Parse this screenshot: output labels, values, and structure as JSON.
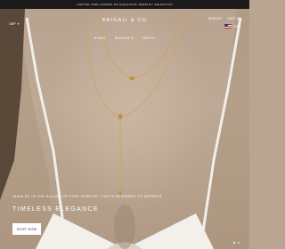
{
  "announcement": "LIMITED-TIME OFFERS ON EXQUISITE JEWELRY SELECTION",
  "brand": "ABIGAIL & CO",
  "nav": {
    "home": "HOME",
    "womens": "WOMEN'S",
    "mens": "MEN'S"
  },
  "currency": "GBP",
  "header_tools": {
    "search": "SEARCH",
    "cart": "CART (0)"
  },
  "locale": "GBP",
  "hero": {
    "subtitle": "INDULGE IN THE ALLURE OF FINE JEWELRY THAT'S DESIGNED TO IMPRESS",
    "title": "TIMELESS ELEGANCE",
    "button": "SHOP NOW"
  },
  "slides": {
    "count": 2,
    "active": 1
  },
  "colors": {
    "announcement_bg": "#1a1a1a",
    "hero_bg": "#b9a592",
    "button_bg": "#ffffff"
  }
}
